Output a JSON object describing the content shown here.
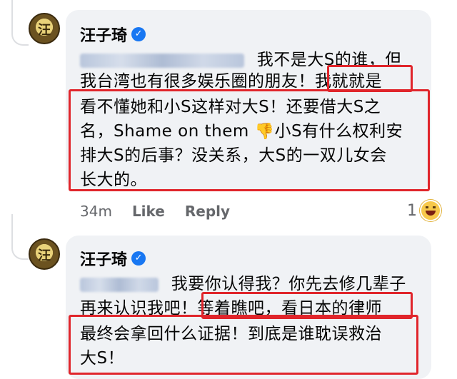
{
  "comment1": {
    "author": "汪子琦",
    "lines": [
      " 我不是大S的谁，但",
      "我台湾也有很多娱乐圈的朋友！我就就是",
      "看不懂她和小S这样对大S！还要借大S之",
      "名，Shame on them ",
      "小S有什么权利安",
      "排大S的后事？没关系，大S的一双儿女会",
      "长大的。"
    ],
    "time": "34m",
    "like": "Like",
    "reply": "Reply",
    "reaction_count": "1"
  },
  "comment2": {
    "author": "汪子琦",
    "lines": [
      " 我要你认得我？你先去修几辈子",
      "再来认识我吧！等着瞧吧，看日本的律师",
      "最终会拿回什么证据！到底是谁耽误救治",
      "大S！"
    ]
  },
  "icons": {
    "verified": "verified-badge-icon",
    "thumbs_down": "thumbs-down-emoji",
    "reaction": "grinning-face-emoji"
  },
  "colors": {
    "bubble": "#f0f2f5",
    "highlight_box": "#e0252b",
    "verified": "#1877f2",
    "meta_text": "#65676b"
  }
}
